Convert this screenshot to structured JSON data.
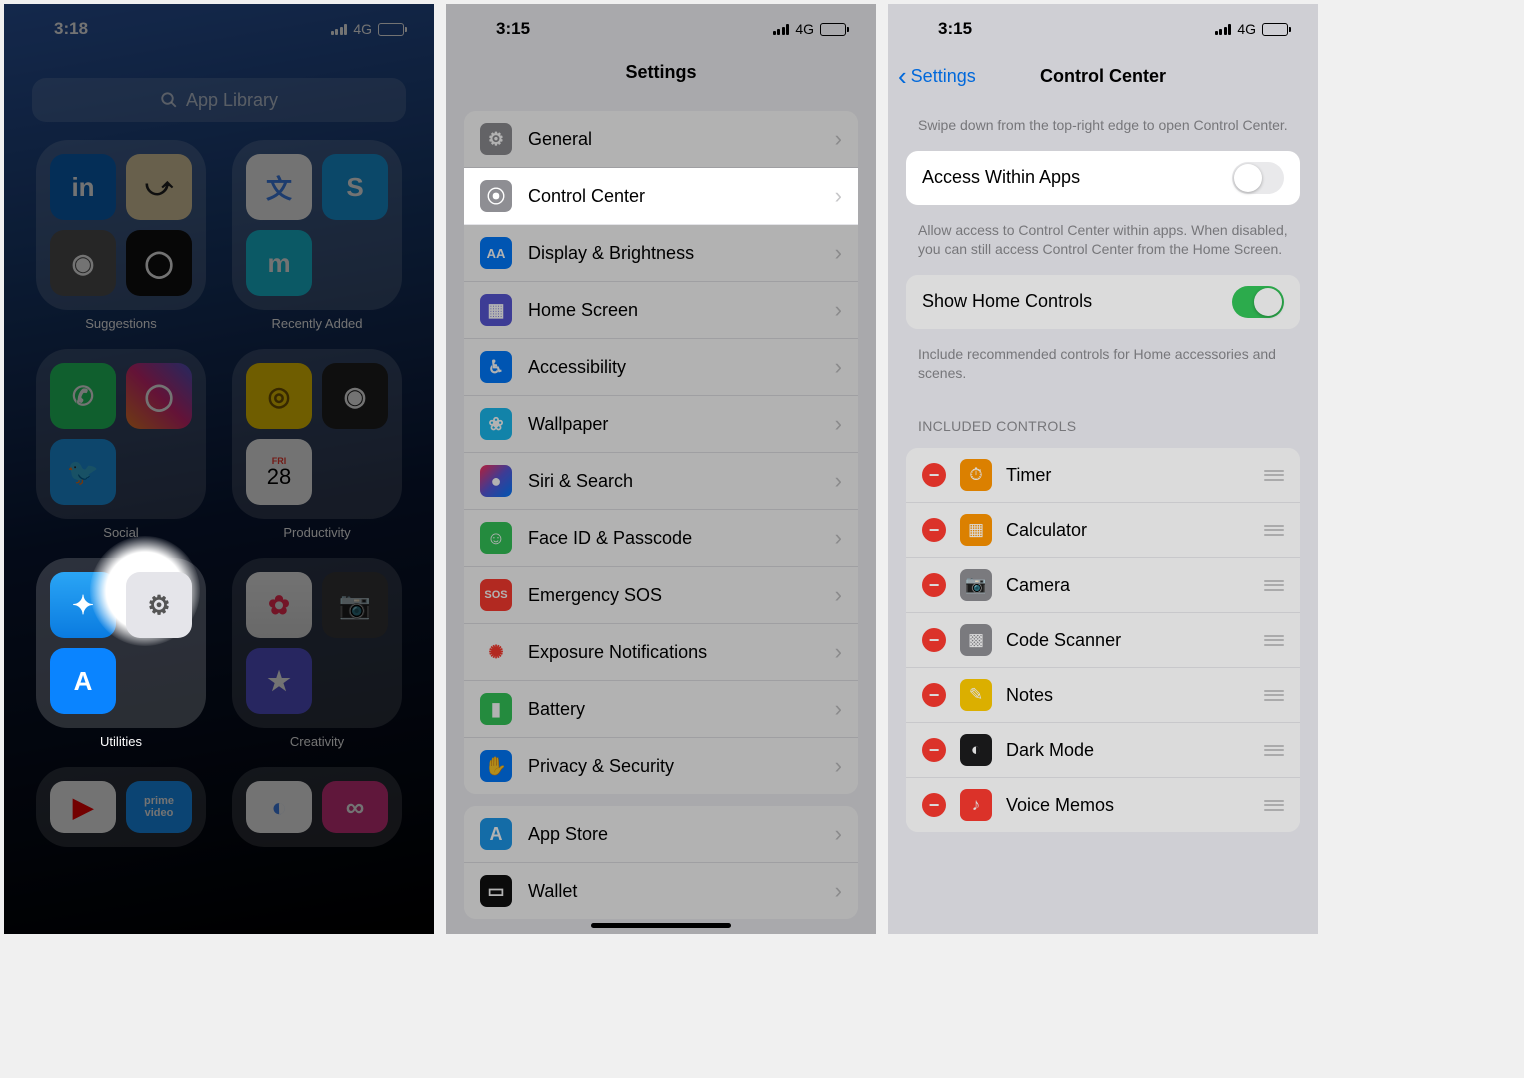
{
  "status": {
    "time1": "3:18",
    "time2": "3:15",
    "time3": "3:15",
    "network": "4G"
  },
  "screen1": {
    "search_placeholder": "App Library",
    "folders": {
      "f0": {
        "label": "Suggestions"
      },
      "f1": {
        "label": "Recently Added"
      },
      "f2": {
        "label": "Social"
      },
      "f3": {
        "label": "Productivity"
      },
      "f4": {
        "label": "Utilities"
      },
      "f5": {
        "label": "Creativity"
      }
    }
  },
  "screen2": {
    "title": "Settings",
    "rows": {
      "general": "General",
      "control_center": "Control Center",
      "display": "Display & Brightness",
      "home_screen": "Home Screen",
      "accessibility": "Accessibility",
      "wallpaper": "Wallpaper",
      "siri": "Siri & Search",
      "faceid": "Face ID & Passcode",
      "sos": "Emergency SOS",
      "exposure": "Exposure Notifications",
      "battery": "Battery",
      "privacy": "Privacy & Security",
      "appstore": "App Store",
      "wallet": "Wallet"
    },
    "sos_badge": "SOS"
  },
  "screen3": {
    "back": "Settings",
    "title": "Control Center",
    "intro": "Swipe down from the top-right edge to open Control Center.",
    "access_label": "Access Within Apps",
    "access_footer": "Allow access to Control Center within apps. When disabled, you can still access Control Center from the Home Screen.",
    "home_controls_label": "Show Home Controls",
    "home_controls_footer": "Include recommended controls for Home accessories and scenes.",
    "included_header": "INCLUDED CONTROLS",
    "items": {
      "timer": "Timer",
      "calculator": "Calculator",
      "camera": "Camera",
      "code_scanner": "Code Scanner",
      "notes": "Notes",
      "dark_mode": "Dark Mode",
      "voice_memos": "Voice Memos"
    }
  },
  "colors": {
    "blue": "#007aff",
    "green": "#34c759",
    "red": "#ff3b30",
    "gray": "#8e8e93",
    "orange": "#ff9500",
    "yellow": "#ffcc00",
    "darkgray": "#6e6e73"
  }
}
